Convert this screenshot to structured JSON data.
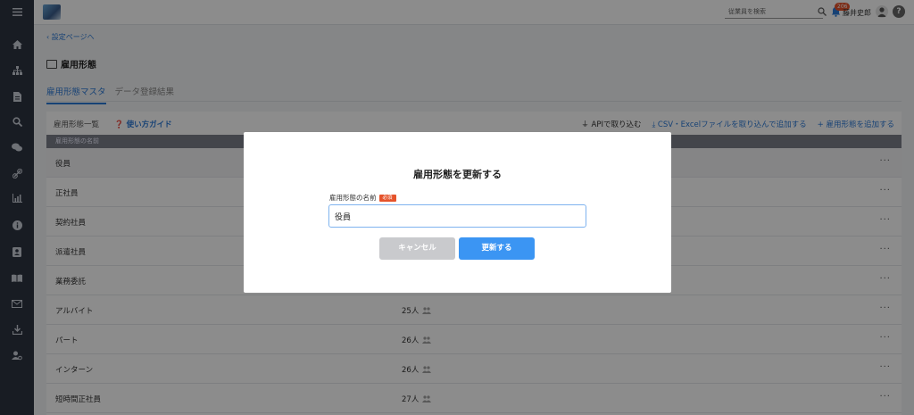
{
  "topbar": {
    "search_placeholder": "従業員を検索",
    "notification_count": "206",
    "user_name": "藤井史郎",
    "help_label": "?"
  },
  "sidebar": {
    "items": [
      "menu-icon",
      "home-icon",
      "org-icon",
      "document-icon",
      "search-icon",
      "chat-icon",
      "link-icon",
      "chart-icon",
      "info-icon",
      "profile-icon",
      "book-icon",
      "mail-icon",
      "download-icon",
      "user-settings-icon"
    ]
  },
  "page": {
    "back_link": "設定ページへ",
    "title": "雇用形態",
    "tabs": [
      {
        "label": "雇用形態マスタ",
        "active": true
      },
      {
        "label": "データ登録結果",
        "active": false
      }
    ]
  },
  "list": {
    "title": "雇用形態一覧",
    "guide_label": "使い方ガイド",
    "api_label": "APIで取り込む",
    "csv_label": "CSV・Excelファイルを取り込んで追加する",
    "add_label": "+ 雇用形態を追加する",
    "column_header": "雇用形態の名前",
    "rows": [
      {
        "name": "役員",
        "count": ""
      },
      {
        "name": "正社員",
        "count": ""
      },
      {
        "name": "契約社員",
        "count": ""
      },
      {
        "name": "派遣社員",
        "count": ""
      },
      {
        "name": "業務委託",
        "count": ""
      },
      {
        "name": "アルバイト",
        "count": "25人"
      },
      {
        "name": "パート",
        "count": "26人"
      },
      {
        "name": "インターン",
        "count": "26人"
      },
      {
        "name": "短時間正社員",
        "count": "27人"
      }
    ]
  },
  "modal": {
    "title": "雇用形態を更新する",
    "field_label": "雇用形態の名前",
    "required_label": "必須",
    "field_value": "役員",
    "cancel_label": "キャンセル",
    "submit_label": "更新する"
  },
  "colors": {
    "accent": "#2b79d6",
    "primary_button": "#3b95f3",
    "required_badge": "#e5532b",
    "sidebar": "#2c3340"
  }
}
